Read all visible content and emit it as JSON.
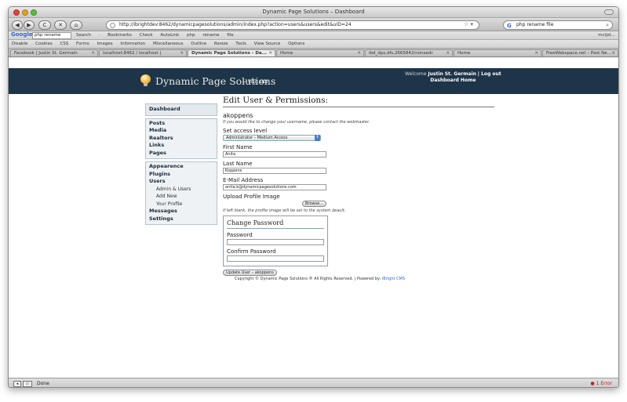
{
  "window": {
    "title": "Dynamic Page Solutions – Dashboard"
  },
  "nav": {
    "back": "◀",
    "forward": "▶",
    "reload": "C",
    "stop": "✕",
    "home": "⌂",
    "url": "http://ibrightdev:8462/dynamicpagesolutions/admin/index.php?action=users&users&edit&uID=24",
    "bookmark_star": "☆ ▾",
    "search_value": "php rename file"
  },
  "google_bar": {
    "logo": "Google",
    "query": "php rename",
    "items": [
      "Search",
      "·",
      "Bookmarks",
      "Check",
      "AutoLink",
      "php",
      "rename",
      "file"
    ],
    "right": "mcijst..."
  },
  "dev_bar": {
    "items": [
      "Disable",
      "Cookies",
      "CSS",
      "Forms",
      "Images",
      "Information",
      "Miscellaneous",
      "Outline",
      "Resize",
      "Tools",
      "View Source",
      "Options"
    ]
  },
  "tabs": [
    {
      "label": "Facebook | Justin St. Germain"
    },
    {
      "label": "localhost:8462 / localhost |"
    },
    {
      "label": "Dynamic Page Solutions – Da..."
    },
    {
      "label": "Home"
    },
    {
      "label": "ibd_dps.dfs.2665842/nonsedr"
    },
    {
      "label": "Home"
    },
    {
      "label": "FreeWebspace.net – Post Ne..."
    }
  ],
  "header": {
    "site_name": "Dynamic Page Solutions",
    "visit_link": "← Visit site",
    "welcome_prefix": "Welcome",
    "user_name": "Justin St. Germain",
    "logout": "| Log out",
    "dashboard_home": "Dashboard Home"
  },
  "sidebar": {
    "dashboard": "Dashboard",
    "group1": [
      "Posts",
      "Media",
      "Realtors",
      "Links",
      "Pages"
    ],
    "group2_top": [
      "Appearence",
      "Plugins",
      "Users"
    ],
    "users_sub": [
      "Admin & Users",
      "Add New",
      "Your Profile"
    ],
    "group2_bottom": [
      "Messages",
      "Settings"
    ]
  },
  "main": {
    "heading": "Edit User & Permissions:",
    "username": "akoppens",
    "username_hint": "If you would like to change your username, please contact the webmaster.",
    "access_label": "Set access level",
    "access_value": "Administrator – Medium Access",
    "first_name_label": "First Name",
    "first_name_value": "Anita",
    "last_name_label": "Last Name",
    "last_name_value": "Koppens",
    "email_label": "E-Mail Address",
    "email_value": "anita.k@dynamicpagesolutions.com",
    "upload_label": "Upload Profile Image",
    "browse_label": "Browse...",
    "upload_hint": "If left blank, the profile image will be set to the system deault.",
    "change_password_heading": "Change Password",
    "password_label": "Password",
    "confirm_password_label": "Confirm Password",
    "submit_label": "Update User – akoppens",
    "footer_text": "Copyright © Dynamic Page Solutions ® All Rights Reserved. | Powered by:",
    "footer_brand": "iBright CMS"
  },
  "status": {
    "text": "Done",
    "error": "1 Error"
  }
}
